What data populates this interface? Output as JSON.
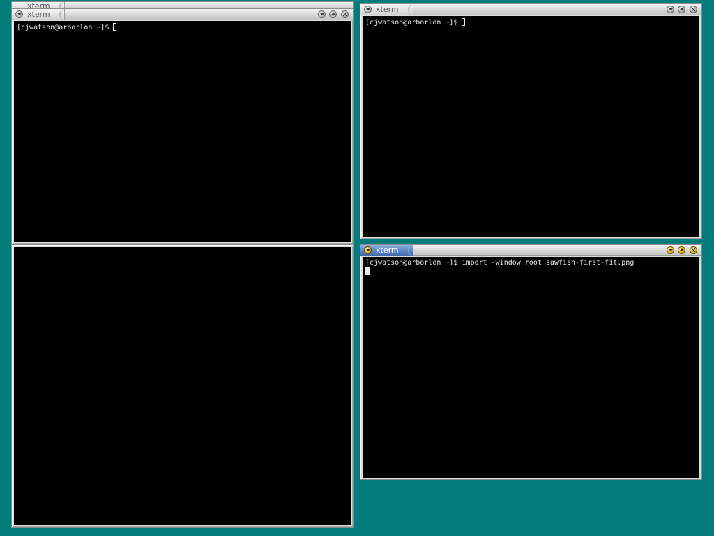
{
  "desktop": {
    "background_color": "#047c7c"
  },
  "colors": {
    "frame": "#dcdcdc",
    "active_title": "#5d86c4",
    "terminal_bg": "#000000",
    "terminal_fg": "#e8e8e8"
  },
  "windows": {
    "behind": {
      "title": "xterm"
    },
    "top_left": {
      "title": "xterm",
      "prompt": "[cjwatson@arborlon ~]$ "
    },
    "top_right": {
      "title": "xterm",
      "prompt": "[cjwatson@arborlon ~]$ "
    },
    "bottom_right": {
      "title": "xterm",
      "prompt": "[cjwatson@arborlon ~]$ ",
      "command": "import -window root sawfish-first-fit.png"
    }
  },
  "icons": [
    "menu-icon",
    "minimize-icon",
    "maximize-icon",
    "close-icon",
    "cursor-icon"
  ]
}
